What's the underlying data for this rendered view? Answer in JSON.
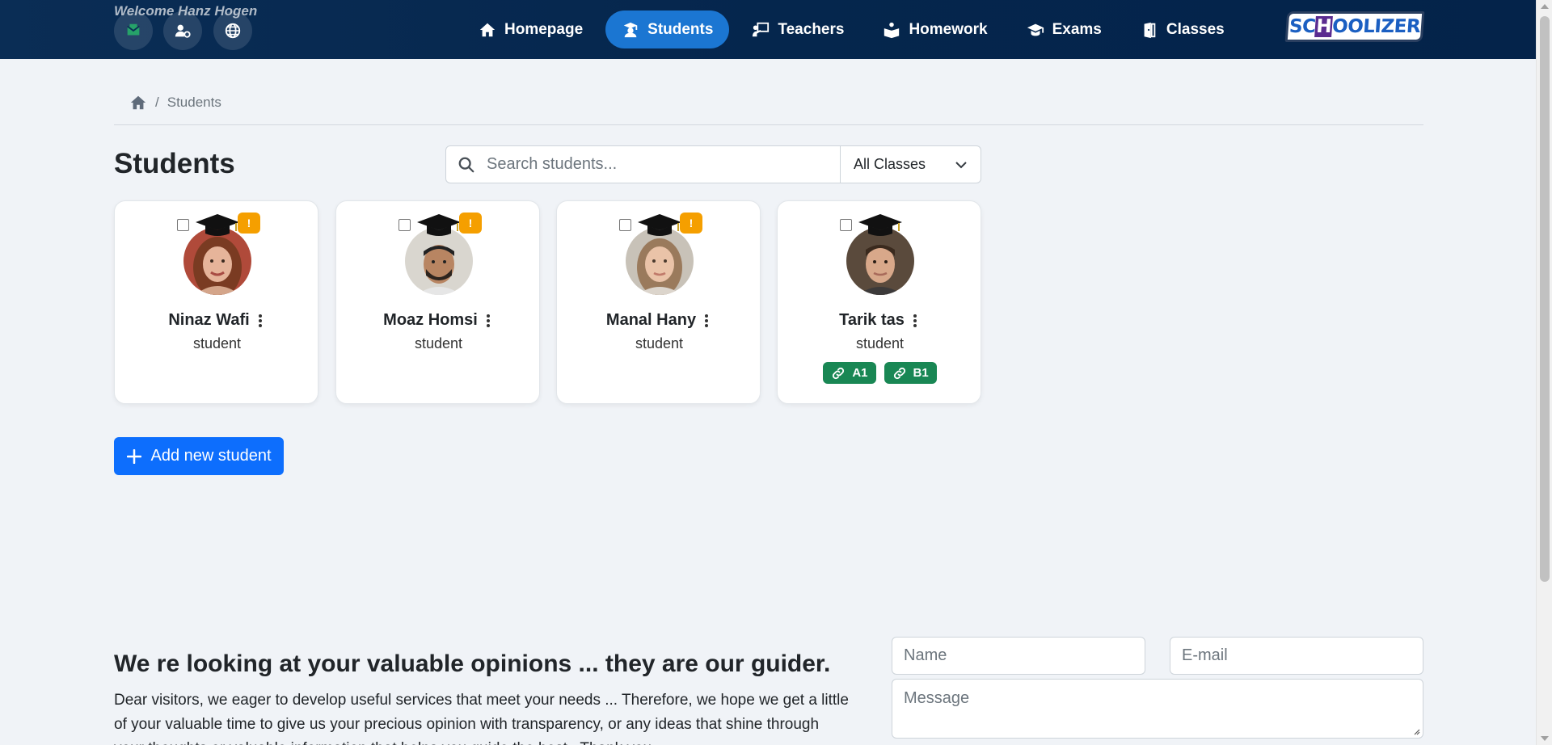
{
  "header": {
    "welcome": "Welcome Hanz Hogen",
    "nav": [
      {
        "label": "Homepage",
        "icon": "home-icon",
        "active": false
      },
      {
        "label": "Students",
        "icon": "student-icon",
        "active": true
      },
      {
        "label": "Teachers",
        "icon": "teacher-icon",
        "active": false
      },
      {
        "label": "Homework",
        "icon": "book-reader-icon",
        "active": false
      },
      {
        "label": "Exams",
        "icon": "graduation-cap-icon",
        "active": false
      },
      {
        "label": "Classes",
        "icon": "door-icon",
        "active": false
      }
    ],
    "logo_text": "SCHOOLIZER",
    "accent_color": "#1b76d2"
  },
  "breadcrumb": {
    "current": "Students"
  },
  "page": {
    "title": "Students",
    "search_placeholder": "Search students...",
    "class_filter": "All Classes"
  },
  "students": [
    {
      "name": "Ninaz Wafi",
      "role": "student",
      "warning": "!",
      "tags": []
    },
    {
      "name": "Moaz Homsi",
      "role": "student",
      "warning": "!",
      "tags": []
    },
    {
      "name": "Manal Hany",
      "role": "student",
      "warning": "!",
      "tags": []
    },
    {
      "name": "Tarik tas",
      "role": "student",
      "warning": "",
      "tags": [
        "A1",
        "B1"
      ]
    }
  ],
  "add_button": "Add new student",
  "feedback": {
    "title": "We re looking at your valuable opinions ... they are our guider.",
    "text": "Dear visitors, we eager to develop useful services that meet your needs ... Therefore, we hope we get a little of your valuable time to give us your precious opinion with transparency, or any ideas that shine through your thoughts or valuable information that helps you guide the best . Thank you.",
    "name_placeholder": "Name",
    "email_placeholder": "E-mail",
    "message_placeholder": "Message"
  }
}
